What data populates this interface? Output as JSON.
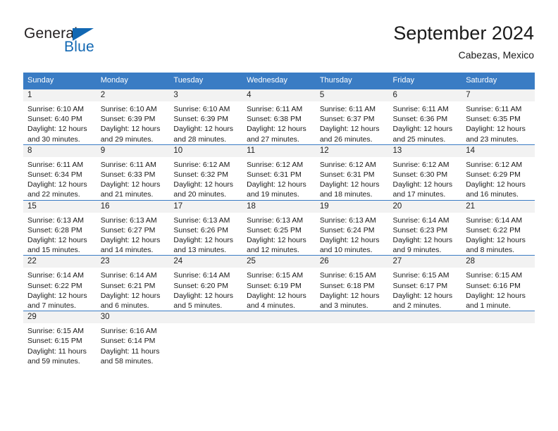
{
  "brand": {
    "name_top": "General",
    "name_bottom": "Blue",
    "color_dark": "#231f20",
    "color_blue": "#1268b3"
  },
  "header": {
    "title": "September 2024",
    "subtitle": "Cabezas, Mexico"
  },
  "theme": {
    "header_row_bg": "#3a7cc4",
    "daynum_band_bg": "#f2f2f2",
    "cell_border": "#3a7cc4"
  },
  "weekdays": [
    "Sunday",
    "Monday",
    "Tuesday",
    "Wednesday",
    "Thursday",
    "Friday",
    "Saturday"
  ],
  "weeks": [
    [
      {
        "day": "1",
        "sunrise": "Sunrise: 6:10 AM",
        "sunset": "Sunset: 6:40 PM",
        "daylight1": "Daylight: 12 hours",
        "daylight2": "and 30 minutes."
      },
      {
        "day": "2",
        "sunrise": "Sunrise: 6:10 AM",
        "sunset": "Sunset: 6:39 PM",
        "daylight1": "Daylight: 12 hours",
        "daylight2": "and 29 minutes."
      },
      {
        "day": "3",
        "sunrise": "Sunrise: 6:10 AM",
        "sunset": "Sunset: 6:39 PM",
        "daylight1": "Daylight: 12 hours",
        "daylight2": "and 28 minutes."
      },
      {
        "day": "4",
        "sunrise": "Sunrise: 6:11 AM",
        "sunset": "Sunset: 6:38 PM",
        "daylight1": "Daylight: 12 hours",
        "daylight2": "and 27 minutes."
      },
      {
        "day": "5",
        "sunrise": "Sunrise: 6:11 AM",
        "sunset": "Sunset: 6:37 PM",
        "daylight1": "Daylight: 12 hours",
        "daylight2": "and 26 minutes."
      },
      {
        "day": "6",
        "sunrise": "Sunrise: 6:11 AM",
        "sunset": "Sunset: 6:36 PM",
        "daylight1": "Daylight: 12 hours",
        "daylight2": "and 25 minutes."
      },
      {
        "day": "7",
        "sunrise": "Sunrise: 6:11 AM",
        "sunset": "Sunset: 6:35 PM",
        "daylight1": "Daylight: 12 hours",
        "daylight2": "and 23 minutes."
      }
    ],
    [
      {
        "day": "8",
        "sunrise": "Sunrise: 6:11 AM",
        "sunset": "Sunset: 6:34 PM",
        "daylight1": "Daylight: 12 hours",
        "daylight2": "and 22 minutes."
      },
      {
        "day": "9",
        "sunrise": "Sunrise: 6:11 AM",
        "sunset": "Sunset: 6:33 PM",
        "daylight1": "Daylight: 12 hours",
        "daylight2": "and 21 minutes."
      },
      {
        "day": "10",
        "sunrise": "Sunrise: 6:12 AM",
        "sunset": "Sunset: 6:32 PM",
        "daylight1": "Daylight: 12 hours",
        "daylight2": "and 20 minutes."
      },
      {
        "day": "11",
        "sunrise": "Sunrise: 6:12 AM",
        "sunset": "Sunset: 6:31 PM",
        "daylight1": "Daylight: 12 hours",
        "daylight2": "and 19 minutes."
      },
      {
        "day": "12",
        "sunrise": "Sunrise: 6:12 AM",
        "sunset": "Sunset: 6:31 PM",
        "daylight1": "Daylight: 12 hours",
        "daylight2": "and 18 minutes."
      },
      {
        "day": "13",
        "sunrise": "Sunrise: 6:12 AM",
        "sunset": "Sunset: 6:30 PM",
        "daylight1": "Daylight: 12 hours",
        "daylight2": "and 17 minutes."
      },
      {
        "day": "14",
        "sunrise": "Sunrise: 6:12 AM",
        "sunset": "Sunset: 6:29 PM",
        "daylight1": "Daylight: 12 hours",
        "daylight2": "and 16 minutes."
      }
    ],
    [
      {
        "day": "15",
        "sunrise": "Sunrise: 6:13 AM",
        "sunset": "Sunset: 6:28 PM",
        "daylight1": "Daylight: 12 hours",
        "daylight2": "and 15 minutes."
      },
      {
        "day": "16",
        "sunrise": "Sunrise: 6:13 AM",
        "sunset": "Sunset: 6:27 PM",
        "daylight1": "Daylight: 12 hours",
        "daylight2": "and 14 minutes."
      },
      {
        "day": "17",
        "sunrise": "Sunrise: 6:13 AM",
        "sunset": "Sunset: 6:26 PM",
        "daylight1": "Daylight: 12 hours",
        "daylight2": "and 13 minutes."
      },
      {
        "day": "18",
        "sunrise": "Sunrise: 6:13 AM",
        "sunset": "Sunset: 6:25 PM",
        "daylight1": "Daylight: 12 hours",
        "daylight2": "and 12 minutes."
      },
      {
        "day": "19",
        "sunrise": "Sunrise: 6:13 AM",
        "sunset": "Sunset: 6:24 PM",
        "daylight1": "Daylight: 12 hours",
        "daylight2": "and 10 minutes."
      },
      {
        "day": "20",
        "sunrise": "Sunrise: 6:14 AM",
        "sunset": "Sunset: 6:23 PM",
        "daylight1": "Daylight: 12 hours",
        "daylight2": "and 9 minutes."
      },
      {
        "day": "21",
        "sunrise": "Sunrise: 6:14 AM",
        "sunset": "Sunset: 6:22 PM",
        "daylight1": "Daylight: 12 hours",
        "daylight2": "and 8 minutes."
      }
    ],
    [
      {
        "day": "22",
        "sunrise": "Sunrise: 6:14 AM",
        "sunset": "Sunset: 6:22 PM",
        "daylight1": "Daylight: 12 hours",
        "daylight2": "and 7 minutes."
      },
      {
        "day": "23",
        "sunrise": "Sunrise: 6:14 AM",
        "sunset": "Sunset: 6:21 PM",
        "daylight1": "Daylight: 12 hours",
        "daylight2": "and 6 minutes."
      },
      {
        "day": "24",
        "sunrise": "Sunrise: 6:14 AM",
        "sunset": "Sunset: 6:20 PM",
        "daylight1": "Daylight: 12 hours",
        "daylight2": "and 5 minutes."
      },
      {
        "day": "25",
        "sunrise": "Sunrise: 6:15 AM",
        "sunset": "Sunset: 6:19 PM",
        "daylight1": "Daylight: 12 hours",
        "daylight2": "and 4 minutes."
      },
      {
        "day": "26",
        "sunrise": "Sunrise: 6:15 AM",
        "sunset": "Sunset: 6:18 PM",
        "daylight1": "Daylight: 12 hours",
        "daylight2": "and 3 minutes."
      },
      {
        "day": "27",
        "sunrise": "Sunrise: 6:15 AM",
        "sunset": "Sunset: 6:17 PM",
        "daylight1": "Daylight: 12 hours",
        "daylight2": "and 2 minutes."
      },
      {
        "day": "28",
        "sunrise": "Sunrise: 6:15 AM",
        "sunset": "Sunset: 6:16 PM",
        "daylight1": "Daylight: 12 hours",
        "daylight2": "and 1 minute."
      }
    ],
    [
      {
        "day": "29",
        "sunrise": "Sunrise: 6:15 AM",
        "sunset": "Sunset: 6:15 PM",
        "daylight1": "Daylight: 11 hours",
        "daylight2": "and 59 minutes."
      },
      {
        "day": "30",
        "sunrise": "Sunrise: 6:16 AM",
        "sunset": "Sunset: 6:14 PM",
        "daylight1": "Daylight: 11 hours",
        "daylight2": "and 58 minutes."
      },
      {
        "day": "",
        "sunrise": "",
        "sunset": "",
        "daylight1": "",
        "daylight2": ""
      },
      {
        "day": "",
        "sunrise": "",
        "sunset": "",
        "daylight1": "",
        "daylight2": ""
      },
      {
        "day": "",
        "sunrise": "",
        "sunset": "",
        "daylight1": "",
        "daylight2": ""
      },
      {
        "day": "",
        "sunrise": "",
        "sunset": "",
        "daylight1": "",
        "daylight2": ""
      },
      {
        "day": "",
        "sunrise": "",
        "sunset": "",
        "daylight1": "",
        "daylight2": ""
      }
    ]
  ]
}
